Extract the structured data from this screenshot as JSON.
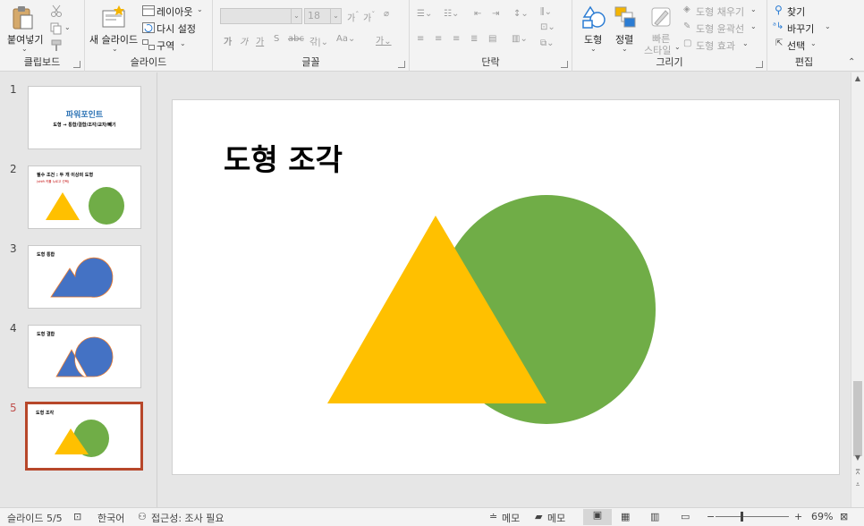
{
  "ribbon": {
    "clipboard": {
      "paste_label": "붙여넣기",
      "group_label": "클립보드"
    },
    "slides": {
      "new_slide_label": "새 슬라이드",
      "layout_label": "레이아웃",
      "reset_label": "다시 설정",
      "section_label": "구역",
      "group_label": "슬라이드"
    },
    "font": {
      "font_name": "",
      "font_size": "18",
      "group_label": "글꼴"
    },
    "paragraph": {
      "group_label": "단락"
    },
    "drawing": {
      "shapes_label": "도형",
      "arrange_label": "정렬",
      "quick_styles_label_1": "빠른",
      "quick_styles_label_2": "스타일",
      "shape_fill_label": "도형 채우기",
      "shape_outline_label": "도형 윤곽선",
      "shape_effects_label": "도형 효과",
      "group_label": "그리기"
    },
    "editing": {
      "find_label": "찾기",
      "replace_label": "바꾸기",
      "select_label": "선택",
      "group_label": "편집"
    }
  },
  "thumbnails": [
    {
      "num": "1",
      "title": "파워포인트",
      "subtitle": "도형 → 통합/결합/조각/교차/빼기"
    },
    {
      "num": "2",
      "title": "필수 조건 : 두 개 이상의 도형",
      "note": "(shift 키를 누르고 선택)"
    },
    {
      "num": "3",
      "title": "도형 통합"
    },
    {
      "num": "4",
      "title": "도형 결합"
    },
    {
      "num": "5",
      "title": "도형 조각"
    }
  ],
  "slide": {
    "title": "도형 조각"
  },
  "colors": {
    "yellow": "#FFC000",
    "green": "#70AD47",
    "blue": "#4472C4",
    "orange_outline": "#ED7D31",
    "active_border": "#B7472A"
  },
  "status": {
    "slide_info": "슬라이드 5/5",
    "language": "한국어",
    "accessibility": "접근성: 조사 필요",
    "notes_label": "메모",
    "comments_label": "메모",
    "zoom": "69%"
  }
}
